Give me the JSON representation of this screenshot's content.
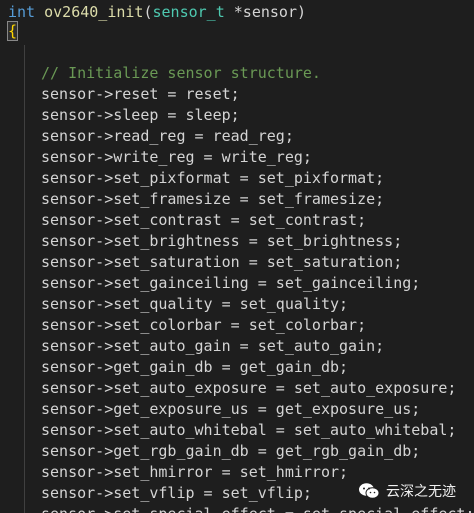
{
  "header": {
    "return_type": "int",
    "function_name": "ov2640_init",
    "open_paren": "(",
    "param_type": "sensor_t",
    "param_rest": " *sensor",
    "close_paren": ")"
  },
  "open_brace": "{",
  "comment": "// Initialize sensor structure.",
  "lines": [
    "sensor->reset = reset;",
    "sensor->sleep = sleep;",
    "sensor->read_reg = read_reg;",
    "sensor->write_reg = write_reg;",
    "sensor->set_pixformat = set_pixformat;",
    "sensor->set_framesize = set_framesize;",
    "sensor->set_contrast = set_contrast;",
    "sensor->set_brightness = set_brightness;",
    "sensor->set_saturation = set_saturation;",
    "sensor->set_gainceiling = set_gainceiling;",
    "sensor->set_quality = set_quality;",
    "sensor->set_colorbar = set_colorbar;",
    "sensor->set_auto_gain = set_auto_gain;",
    "sensor->get_gain_db = get_gain_db;",
    "sensor->set_auto_exposure = set_auto_exposure;",
    "sensor->get_exposure_us = get_exposure_us;",
    "sensor->set_auto_whitebal = set_auto_whitebal;",
    "sensor->get_rgb_gain_db = get_rgb_gain_db;",
    "sensor->set_hmirror = set_hmirror;",
    "sensor->set_vflip = set_vflip;",
    "sensor->set_special_effect = set_special_effect;"
  ],
  "watermark": {
    "icon": "wechat-icon",
    "text": "云深之无迹"
  },
  "colors": {
    "background": "#1e1e1e",
    "text": "#d4d4d4",
    "keyword": "#569cd6",
    "function": "#dcdcaa",
    "type": "#4ec9b0",
    "comment": "#6a9955",
    "brace": "#ffd700"
  }
}
